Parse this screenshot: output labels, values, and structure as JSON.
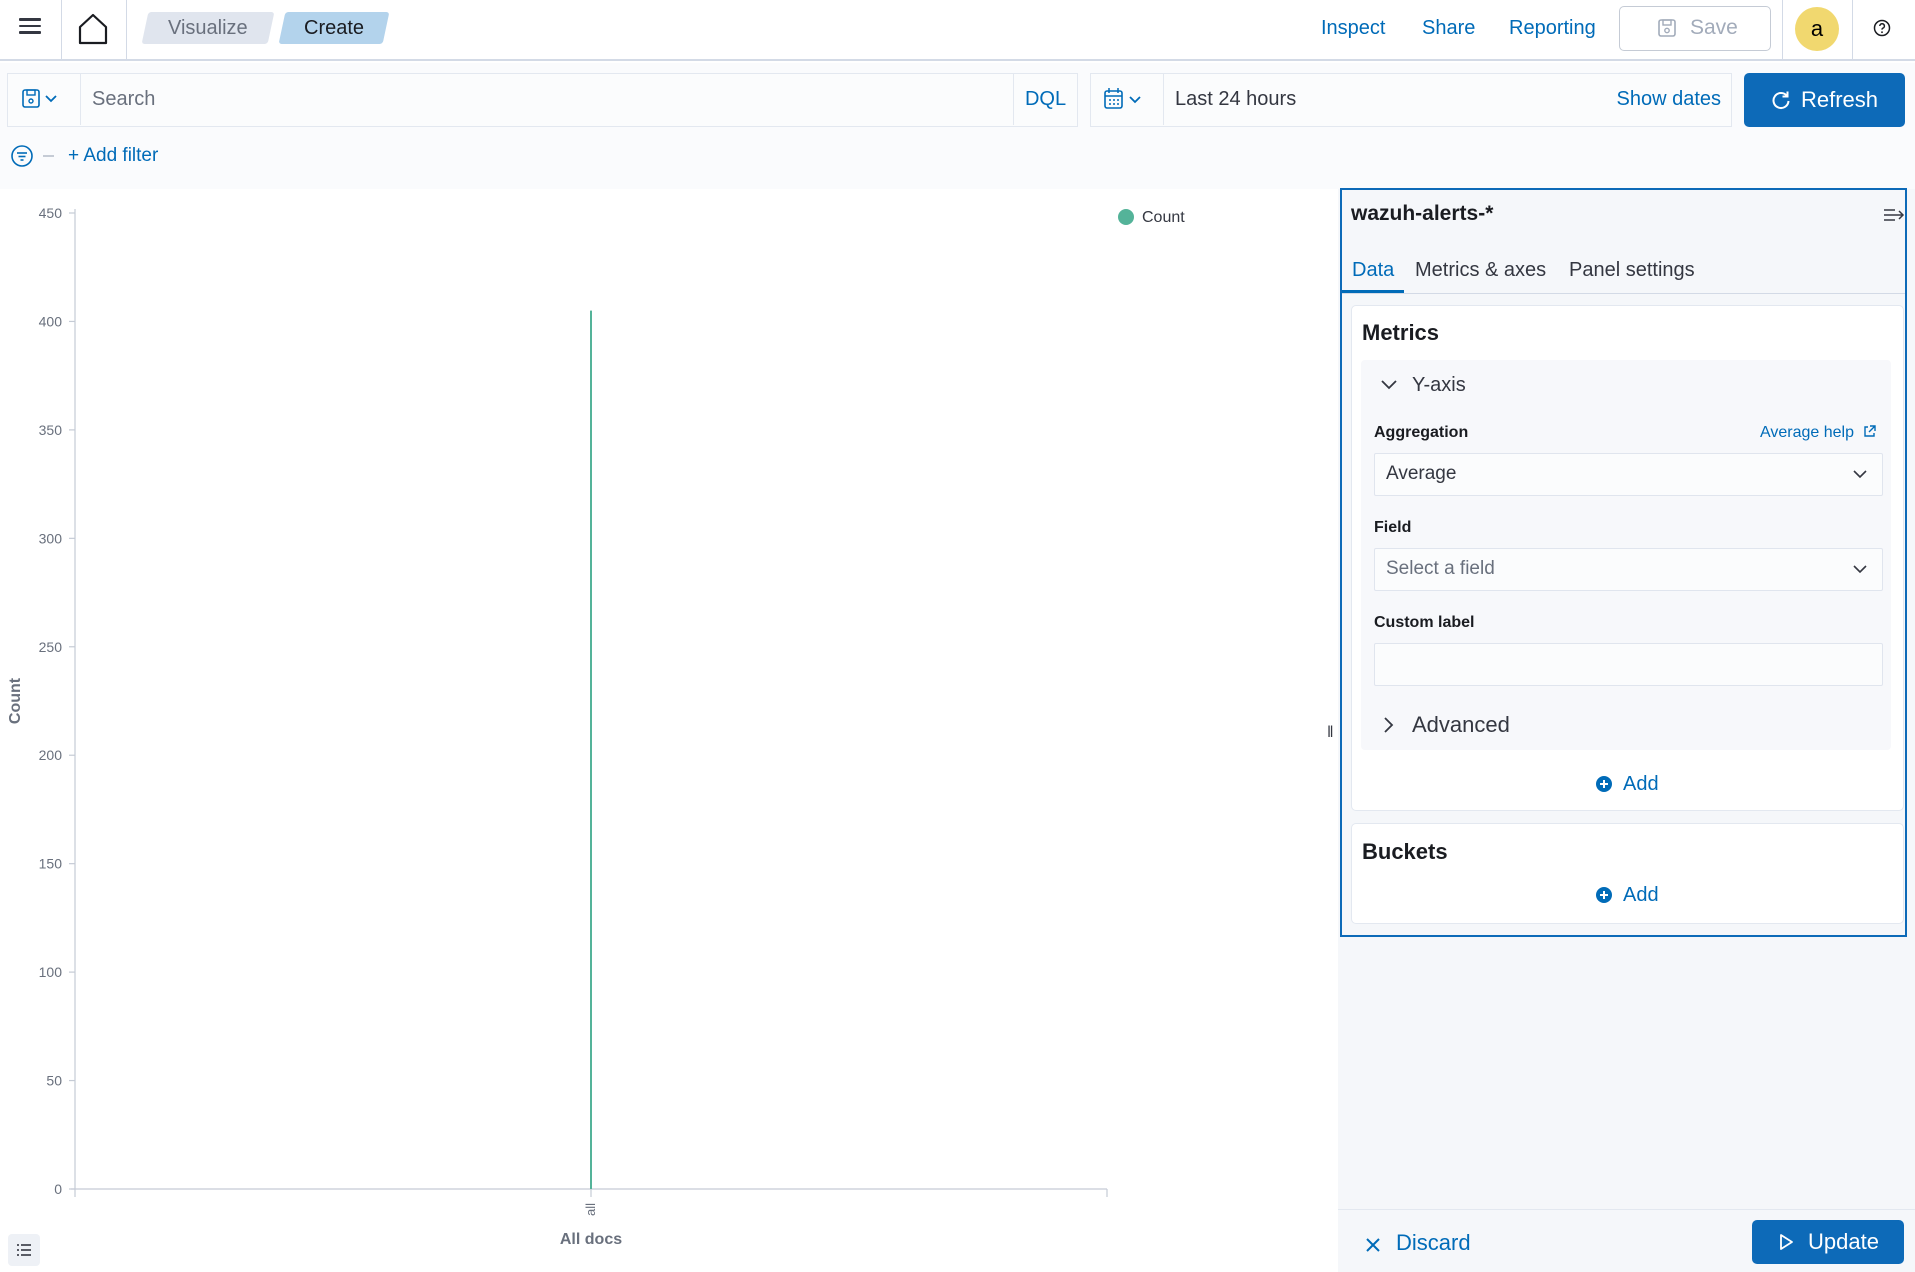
{
  "header": {
    "breadcrumbs": [
      "Visualize",
      "Create"
    ],
    "links": {
      "inspect": "Inspect",
      "share": "Share",
      "reporting": "Reporting"
    },
    "save_label": "Save",
    "avatar_initial": "a"
  },
  "query": {
    "search_placeholder": "Search",
    "language": "DQL",
    "time_range": "Last 24 hours",
    "show_dates": "Show dates",
    "refresh_label": "Refresh",
    "add_filter": "+ Add filter"
  },
  "chart_data": {
    "type": "bar",
    "categories": [
      "all"
    ],
    "series": [
      {
        "name": "Count",
        "values": [
          405
        ]
      }
    ],
    "xlabel": "All docs",
    "ylabel": "Count",
    "ylim": [
      0,
      450
    ],
    "yticks": [
      0,
      50,
      100,
      150,
      200,
      250,
      300,
      350,
      400,
      450
    ],
    "legend": "top-right",
    "color": "#54b399"
  },
  "editor": {
    "index_pattern": "wazuh-alerts-*",
    "tabs": [
      "Data",
      "Metrics & axes",
      "Panel settings"
    ],
    "metrics_title": "Metrics",
    "yaxis_label": "Y-axis",
    "aggregation_label": "Aggregation",
    "aggregation_help": "Average help",
    "aggregation_value": "Average",
    "field_label": "Field",
    "field_placeholder": "Select a field",
    "custom_label": "Custom label",
    "custom_label_value": "",
    "advanced_label": "Advanced",
    "add_label": "Add",
    "buckets_title": "Buckets",
    "discard_label": "Discard",
    "update_label": "Update"
  },
  "colors": {
    "accent": "#006bb8",
    "primary_button": "#0d6ab8",
    "series": "#54b399",
    "avatar": "#f1d86f"
  }
}
